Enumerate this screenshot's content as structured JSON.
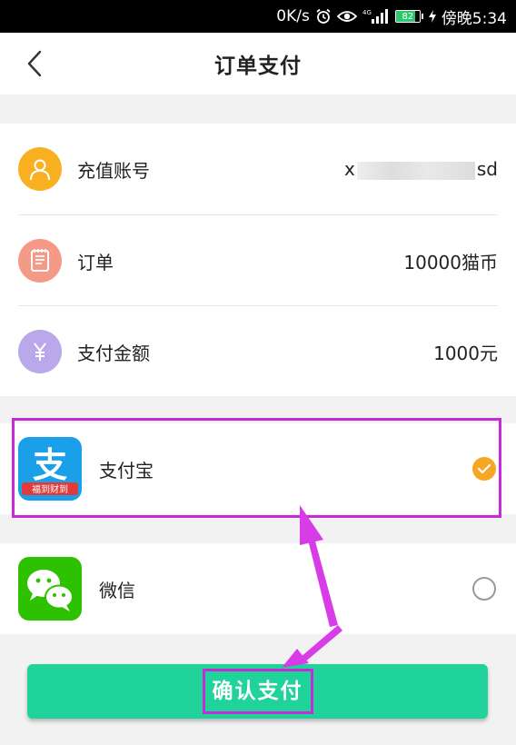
{
  "status_bar": {
    "net_speed": "0K/s",
    "signal_label": "4G",
    "battery_level": "82",
    "time": "傍晚5:34"
  },
  "nav": {
    "title": "订单支付",
    "back_icon": "chevron-left-icon"
  },
  "order": {
    "rows": [
      {
        "label": "充值账号",
        "value_prefix": "x",
        "value_suffix": "sd",
        "icon": "user-icon",
        "color": "#f9b020"
      },
      {
        "label": "订单",
        "value": "10000猫币",
        "icon": "receipt-icon",
        "color": "#f59a87"
      },
      {
        "label": "支付金额",
        "value": "1000元",
        "icon": "yuan-icon",
        "color": "#b9a8ea"
      }
    ]
  },
  "payment": {
    "alipay": {
      "label": "支付宝",
      "logo_char": "支",
      "banner": "福到财到",
      "selected": true,
      "color": "#1aa0e8",
      "banner_color": "#e03a3a"
    },
    "wechat": {
      "label": "微信",
      "selected": false,
      "color": "#2dc100"
    }
  },
  "confirm": {
    "label": "确认支付",
    "color": "#1fd39a"
  },
  "annotation_color": "#c52bd6"
}
